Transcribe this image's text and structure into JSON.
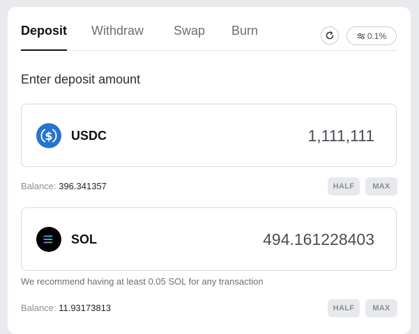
{
  "tabs": [
    {
      "label": "Deposit",
      "active": true
    },
    {
      "label": "Withdraw",
      "active": false
    },
    {
      "label": "Swap",
      "active": false
    },
    {
      "label": "Burn",
      "active": false
    }
  ],
  "toolbar": {
    "refresh_icon": "refresh-icon",
    "slippage_icon": "sliders-icon",
    "slippage_label": "0.1%"
  },
  "deposit": {
    "section_label": "Enter deposit amount",
    "tokens": [
      {
        "symbol": "USDC",
        "amount": "1,111,111",
        "balance_label": "Balance:",
        "balance_value": "396.341357",
        "half_label": "HALF",
        "max_label": "MAX",
        "icon": "usdc-icon",
        "icon_color": "#2775CA"
      },
      {
        "symbol": "SOL",
        "amount": "494.161228403",
        "balance_label": "Balance:",
        "balance_value": "11.93173813",
        "half_label": "HALF",
        "max_label": "MAX",
        "icon": "solana-icon",
        "icon_color": "#000000"
      }
    ],
    "recommendation": "We recommend having at least 0.05 SOL for any transaction"
  }
}
